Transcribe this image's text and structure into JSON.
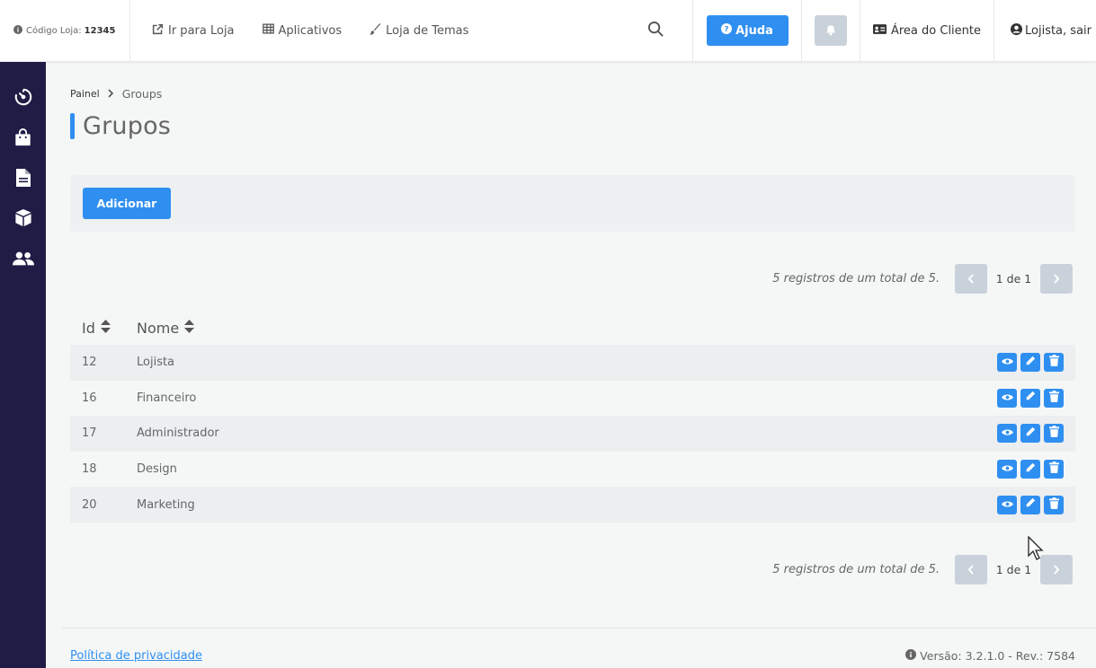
{
  "header": {
    "store_code_label": "Código Loja:",
    "store_code_value": "12345",
    "nav": [
      {
        "label": "Ir para Loja",
        "icon": "external-link-icon"
      },
      {
        "label": "Aplicativos",
        "icon": "grid-table-icon"
      },
      {
        "label": "Loja de Temas",
        "icon": "paintbrush-icon"
      }
    ],
    "help_label": "Ajuda",
    "client_area_label": "Área do Cliente",
    "user_label": "Lojista, sair"
  },
  "sidebar": {
    "items": [
      {
        "icon": "dashboard-timer-icon"
      },
      {
        "icon": "shopping-bag-icon"
      },
      {
        "icon": "document-icon"
      },
      {
        "icon": "box-icon"
      },
      {
        "icon": "users-icon"
      }
    ]
  },
  "breadcrumb": {
    "home": "Painel",
    "current": "Groups"
  },
  "page": {
    "title": "Grupos",
    "add_label": "Adicionar"
  },
  "pagination": {
    "summary": "5 registros de um total de 5.",
    "info": "1 de 1"
  },
  "table": {
    "columns": [
      "Id",
      "Nome"
    ],
    "rows": [
      {
        "id": "12",
        "name": "Lojista"
      },
      {
        "id": "16",
        "name": "Financeiro"
      },
      {
        "id": "17",
        "name": "Administrador"
      },
      {
        "id": "18",
        "name": "Design"
      },
      {
        "id": "20",
        "name": "Marketing"
      }
    ]
  },
  "footer": {
    "privacy_label": "Política de privacidade",
    "version_label": "Versão: 3.2.1.0 - Rev.: 7584"
  },
  "colors": {
    "accent": "#2f8ff0",
    "sidebar": "#1f1d45",
    "disabled_button": "#c9d2da"
  }
}
